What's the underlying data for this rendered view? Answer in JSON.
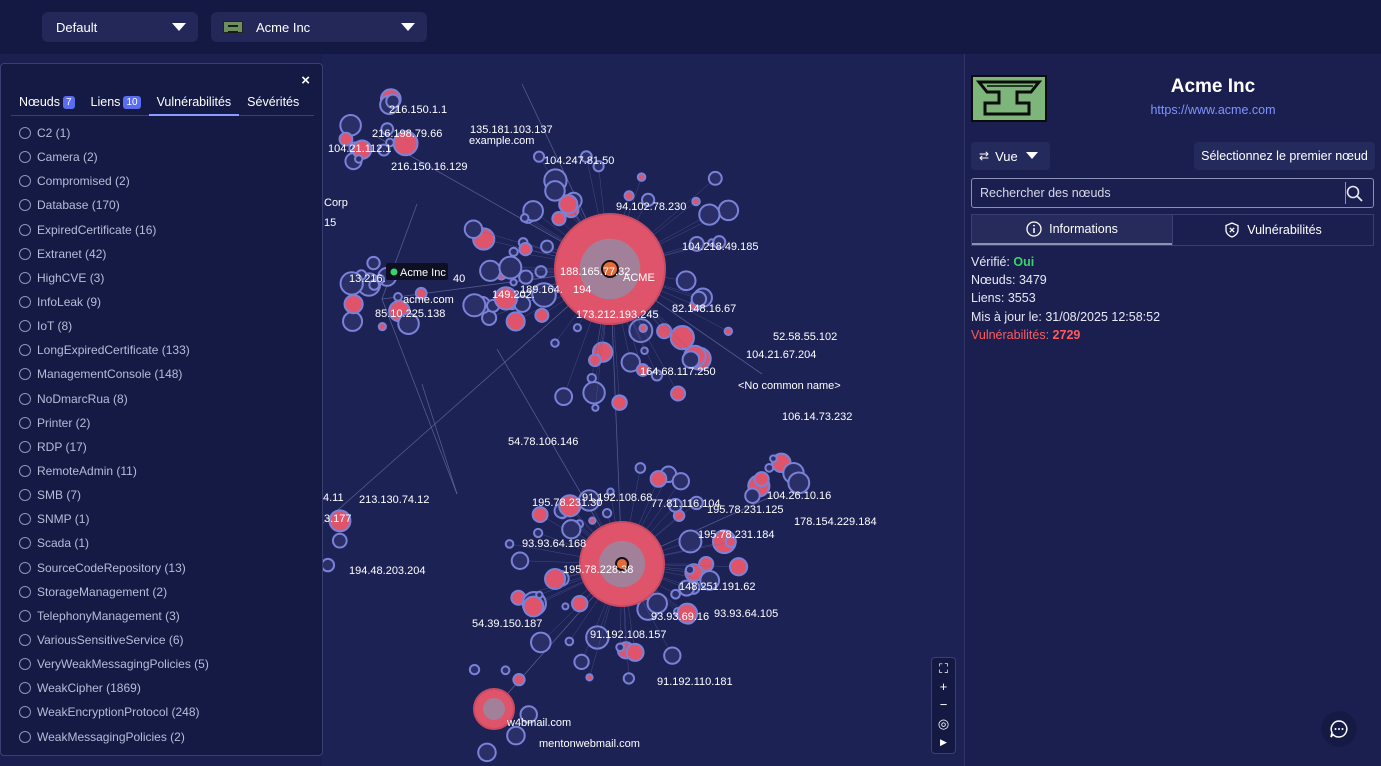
{
  "topbar": {
    "view_select": "Default",
    "org_select": "Acme Inc"
  },
  "filters": {
    "close": "×",
    "tabs": [
      {
        "label": "Nœuds",
        "badge": "7"
      },
      {
        "label": "Liens",
        "badge": "10"
      },
      {
        "label": "Vulnérabilités",
        "badge": ""
      },
      {
        "label": "Sévérités",
        "badge": ""
      }
    ],
    "vulnerabilities": [
      "C2 (1)",
      "Camera (2)",
      "Compromised (2)",
      "Database (170)",
      "ExpiredCertificate (16)",
      "Extranet (42)",
      "HighCVE (3)",
      "InfoLeak (9)",
      "IoT (8)",
      "LongExpiredCertificate (133)",
      "ManagementConsole (148)",
      "NoDmarcRua (8)",
      "Printer (2)",
      "RDP (17)",
      "RemoteAdmin (11)",
      "SMB (7)",
      "SNMP (1)",
      "Scada (1)",
      "SourceCodeRepository (13)",
      "StorageManagement (2)",
      "TelephonyManagement (3)",
      "VariousSensitiveService (6)",
      "VeryWeakMessagingPolicies (5)",
      "WeakCipher (1869)",
      "WeakEncryptionProtocol (248)",
      "WeakMessagingPolicies (2)"
    ]
  },
  "graph": {
    "labels": [
      "216.150.1.1",
      "216.198.79.66",
      "135.181.103.137",
      "example.com",
      "104.21.112.1",
      "216.150.16.129",
      "104.247.81.50",
      "94.102.78.230",
      "104.218.49.185",
      "Corp",
      "15",
      "188.165.77.32",
      "ACME",
      "13.216.",
      "40",
      "acme.com",
      "149.202.",
      "189.164.",
      "194",
      "85.10.225.138",
      "173.212.193.245",
      "82.148.16.67",
      "52.58.55.102",
      "104.21.67.204",
      "164.68.117.250",
      "<No common name>",
      "106.14.73.232",
      "54.78.106.146",
      "4.11",
      "213.130.74.12",
      "3.177",
      "195.78.231.30",
      "91.192.108.68",
      "77.81.116.104",
      "195.78.231.125",
      "104.26.10.16",
      "178.154.229.184",
      "195.78.231.184",
      "93.93.64.168",
      "195.78.228.38",
      "148.251.191.62",
      "194.48.203.204",
      "93.93.69.16",
      "93.93.64.105",
      "54.39.150.187",
      "91.192.108.157",
      "91.192.110.181",
      "w4bmail.com",
      "mentonwebmail.com"
    ],
    "tooltip": "Acme Inc"
  },
  "zoom": {
    "fit": "⛶",
    "in": "+",
    "out": "−",
    "center": "◎",
    "play": "▶"
  },
  "details": {
    "org_name": "Acme Inc",
    "org_url": "https://www.acme.com",
    "vue_label": "Vue",
    "first_node_label": "Sélectionnez le premier nœud",
    "search_placeholder": "Rechercher des nœuds",
    "tab_info": "Informations",
    "tab_vulns": "Vulnérabilités",
    "verified_label": "Vérifié:",
    "verified_value": "Oui",
    "nodes_label": "Nœuds:",
    "nodes_value": "3479",
    "links_label": "Liens:",
    "links_value": "3553",
    "updated_label": "Mis à jour le:",
    "updated_value": "31/08/2025 12:58:52",
    "vulns_label": "Vulnérabilités:",
    "vulns_value": "2729"
  },
  "colors": {
    "accent": "#7f95ff",
    "ok": "#38d46a",
    "danger": "#ff5b5b",
    "node_ring": "#7a82d8",
    "node_red": "#e0546b"
  }
}
